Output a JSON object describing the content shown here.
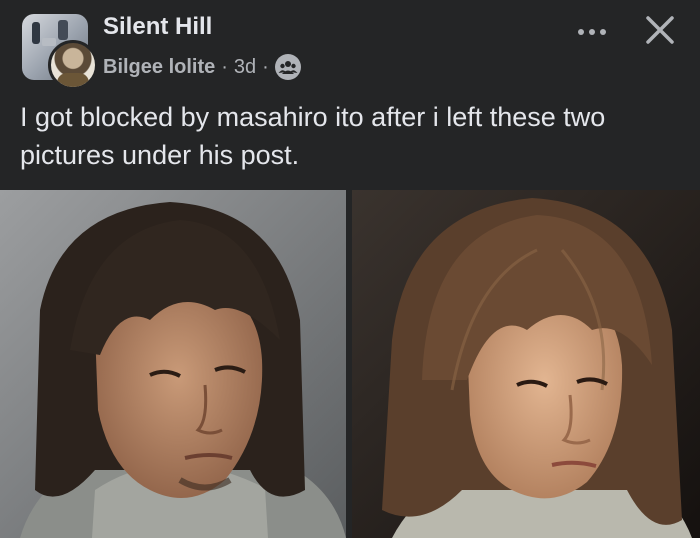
{
  "post": {
    "group_name": "Silent Hill",
    "author": "Bilgee lolite",
    "separator": "·",
    "time": "3d",
    "text": "I got blocked by masahiro ito after i left these two pictures under his post."
  },
  "icons": {
    "more": "more-horizontal-icon",
    "close": "close-icon",
    "audience": "group-audience-icon"
  },
  "photos": [
    {
      "subject": "man with shoulder-length dark hair and grey turtleneck"
    },
    {
      "subject": "young man with brown layered hair and light turtleneck"
    }
  ],
  "colors": {
    "background": "#242526",
    "primary_text": "#e4e6eb",
    "secondary_text": "#b0b3b8"
  }
}
